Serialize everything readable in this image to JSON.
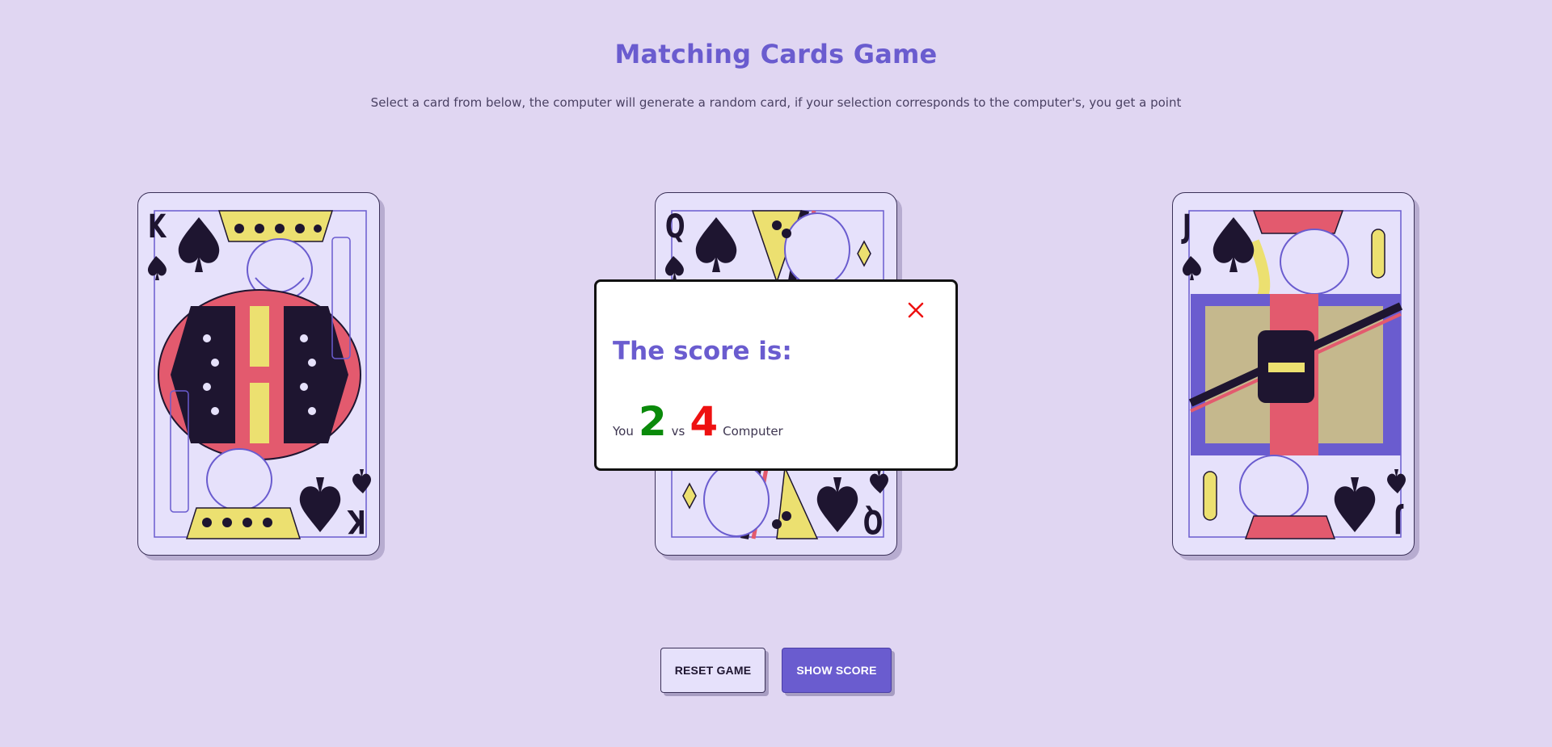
{
  "header": {
    "title": "Matching Cards Game",
    "subtitle": "Select a card from below, the computer will generate a random card, if your selection corresponds to the computer's, you get a point"
  },
  "cards": [
    {
      "rank": "K",
      "suit": "spades",
      "name": "King of Spades"
    },
    {
      "rank": "Q",
      "suit": "spades",
      "name": "Queen of Spades"
    },
    {
      "rank": "J",
      "suit": "spades",
      "name": "Jack of Spades"
    }
  ],
  "modal": {
    "heading": "The score is:",
    "you_label": "You",
    "you_score": "2",
    "vs_label": "vs",
    "computer_score": "4",
    "computer_label": "Computer",
    "close_icon": "close-icon"
  },
  "buttons": {
    "reset_label": "RESET GAME",
    "show_label": "SHOW SCORE"
  },
  "colors": {
    "background": "#e0d6f2",
    "accent": "#6a5ccf",
    "card_face": "#e6e1fb",
    "you_score": "#0a8a0a",
    "computer_score": "#ee1111",
    "card_red": "#e35a6e",
    "card_yellow": "#ece070",
    "card_purple": "#6a5ccf"
  }
}
